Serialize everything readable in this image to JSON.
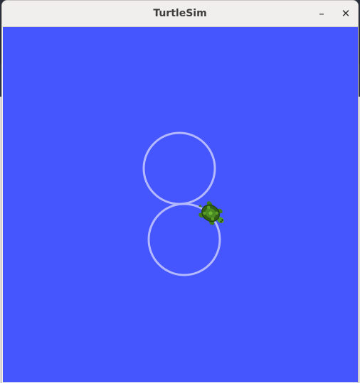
{
  "window": {
    "title": "TurtleSim",
    "minimize_symbol": "–",
    "close_symbol": "✕"
  },
  "canvas": {
    "background_color": "#4556ff",
    "pen_color": "#b3b8ff",
    "turtle_icon": "turtle-icon"
  }
}
